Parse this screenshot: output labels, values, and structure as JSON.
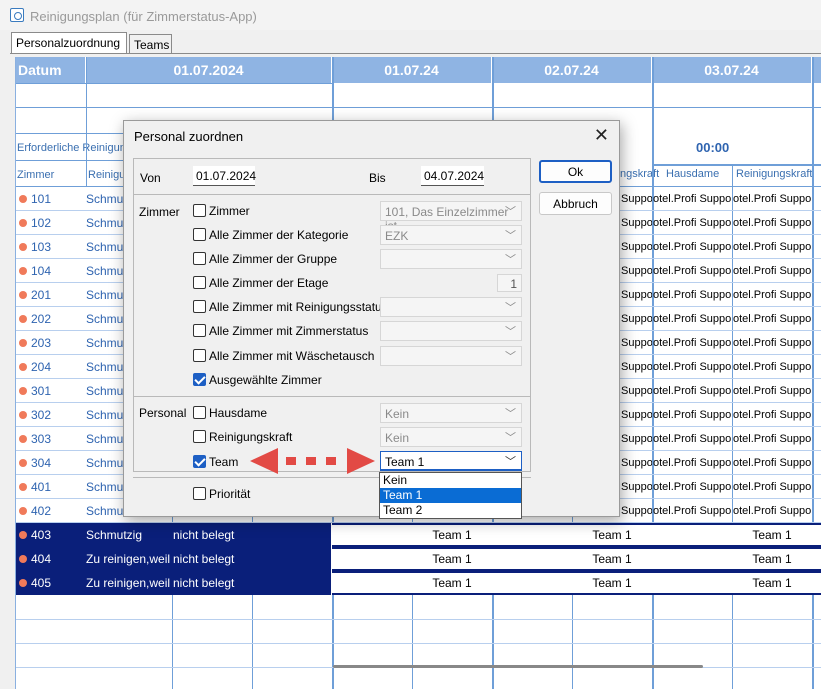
{
  "window": {
    "title": "Reinigungsplan (für Zimmerstatus-App)"
  },
  "tabs": [
    {
      "label": "Personalzuordnung",
      "active": true
    },
    {
      "label": "Teams",
      "active": false
    }
  ],
  "grid": {
    "header_datum": "Datum",
    "date_group": "01.07.2024",
    "day_headers": [
      "01.07.24",
      "02.07.24",
      "03.07.24"
    ],
    "erforderliche": "Erforderliche Reinigung",
    "time": "00:00",
    "col_zimmer": "Zimmer",
    "col_reinigung": "Reinigung",
    "col_hausdame": "Hausdame",
    "col_reinigungskraft": "Reinigungskraft",
    "col_reinigungskraft_trunc": "ngskraft",
    "rows": [
      {
        "room": "101",
        "status": "Schmutz"
      },
      {
        "room": "102",
        "status": "Schmutz"
      },
      {
        "room": "103",
        "status": "Schmutz"
      },
      {
        "room": "104",
        "status": "Schmutz"
      },
      {
        "room": "201",
        "status": "Schmutz"
      },
      {
        "room": "202",
        "status": "Schmutz"
      },
      {
        "room": "203",
        "status": "Schmutz"
      },
      {
        "room": "204",
        "status": "Schmutz"
      },
      {
        "room": "301",
        "status": "Schmutz"
      },
      {
        "room": "302",
        "status": "Schmutz"
      },
      {
        "room": "303",
        "status": "Schmutz"
      },
      {
        "room": "304",
        "status": "Schmutz"
      },
      {
        "room": "401",
        "status": "Schmutz"
      },
      {
        "room": "402",
        "status": "Schmutz"
      }
    ],
    "support_text": "otel.Profi Suppo",
    "support_text_a": "Suppo",
    "selected_rows": [
      {
        "room": "403",
        "status": "Schmutzig",
        "occupancy": "nicht belegt",
        "team": "Team 1"
      },
      {
        "room": "404",
        "status": "Zu reinigen,weil a",
        "occupancy": "nicht belegt",
        "team": "Team 1"
      },
      {
        "room": "405",
        "status": "Zu reinigen,weil a",
        "occupancy": "nicht belegt",
        "team": "Team 1"
      }
    ]
  },
  "dialog": {
    "title": "Personal zuordnen",
    "close_icon": "close-icon",
    "von_label": "Von",
    "von_value": "01.07.2024",
    "bis_label": "Bis",
    "bis_value": "04.07.2024",
    "ok_label": "Ok",
    "cancel_label": "Abbruch",
    "zimmer_section": "Zimmer",
    "zimmer_options": [
      {
        "label": "Zimmer",
        "checked": false,
        "combo": "101, Das Einzelzimmer ist"
      },
      {
        "label": "Alle Zimmer der Kategorie",
        "checked": false,
        "combo": "EZK"
      },
      {
        "label": "Alle Zimmer der Gruppe",
        "checked": false,
        "combo": ""
      },
      {
        "label": "Alle Zimmer der Etage",
        "checked": false,
        "number": "1"
      },
      {
        "label": "Alle Zimmer mit Reinigungsstatus",
        "checked": false,
        "combo": ""
      },
      {
        "label": "Alle Zimmer mit Zimmerstatus",
        "checked": false,
        "combo": ""
      },
      {
        "label": "Alle Zimmer mit Wäschetausch",
        "checked": false,
        "combo": ""
      },
      {
        "label": "Ausgewählte Zimmer",
        "checked": true
      }
    ],
    "personal_section": "Personal",
    "personal_options": [
      {
        "label": "Hausdame",
        "checked": false,
        "combo": "Kein"
      },
      {
        "label": "Reinigungskraft",
        "checked": false,
        "combo": "Kein"
      },
      {
        "label": "Team",
        "checked": true,
        "combo": "Team 1"
      }
    ],
    "prioritaet_label": "Priorität",
    "dropdown_options": [
      "Kein",
      "Team 1",
      "Team 2"
    ],
    "dropdown_selected": "Team 1"
  },
  "colors": {
    "header_blue": "#8fb4e3",
    "selection_navy": "#0a1f7a",
    "accent": "#1d5fc4",
    "arrow_red": "#e24a45"
  }
}
